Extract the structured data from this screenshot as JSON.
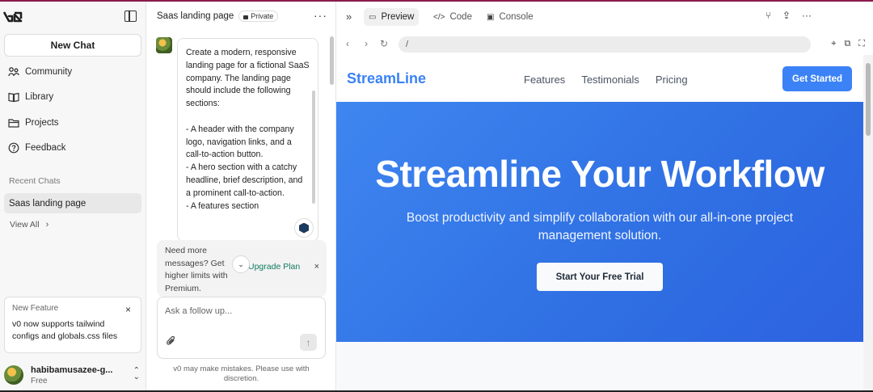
{
  "sidebar": {
    "new_chat": "New Chat",
    "nav": [
      {
        "label": "Community",
        "icon": "community-icon"
      },
      {
        "label": "Library",
        "icon": "book-icon"
      },
      {
        "label": "Projects",
        "icon": "folder-icon"
      },
      {
        "label": "Feedback",
        "icon": "help-circle-icon"
      }
    ],
    "recent_label": "Recent Chats",
    "recent_items": [
      "Saas landing page"
    ],
    "view_all": "View All",
    "feature_card": {
      "title": "New Feature",
      "close": "×",
      "body": "v0 now supports tailwind configs and globals.css files"
    },
    "user": {
      "name": "habibamusazee-g...",
      "plan": "Free"
    }
  },
  "chat": {
    "title": "Saas landing page",
    "visibility": "Private",
    "message": "Create a modern, responsive landing page for a fictional SaaS company. The landing page should include the following sections:\n\n- A header with the company logo, navigation links, and a call-to-action button.\n- A hero section with a catchy headline, brief description, and a prominent call-to-action.\n- A features section",
    "upgrade": {
      "text": "Need more messages? Get higher limits with Premium.",
      "link": "Upgrade Plan",
      "close": "×"
    },
    "input_placeholder": "Ask a follow up...",
    "disclaimer": "v0 may make mistakes. Please use with discretion."
  },
  "preview": {
    "tabs": [
      {
        "label": "Preview",
        "active": true
      },
      {
        "label": "Code",
        "active": false
      },
      {
        "label": "Console",
        "active": false
      }
    ],
    "url": "/",
    "site": {
      "brand": "StreamLine",
      "links": [
        "Features",
        "Testimonials",
        "Pricing"
      ],
      "nav_cta": "Get Started",
      "hero_title": "Streamline Your Workflow",
      "hero_subtitle": "Boost productivity and simplify collaboration with our all-in-one project management solution.",
      "hero_cta": "Start Your Free Trial"
    }
  },
  "colors": {
    "brand_blue": "#3b82f6",
    "hero_blue": "#2f6fe3",
    "upgrade_link": "#0f7b5f",
    "top_accent": "#8a1a4d"
  }
}
